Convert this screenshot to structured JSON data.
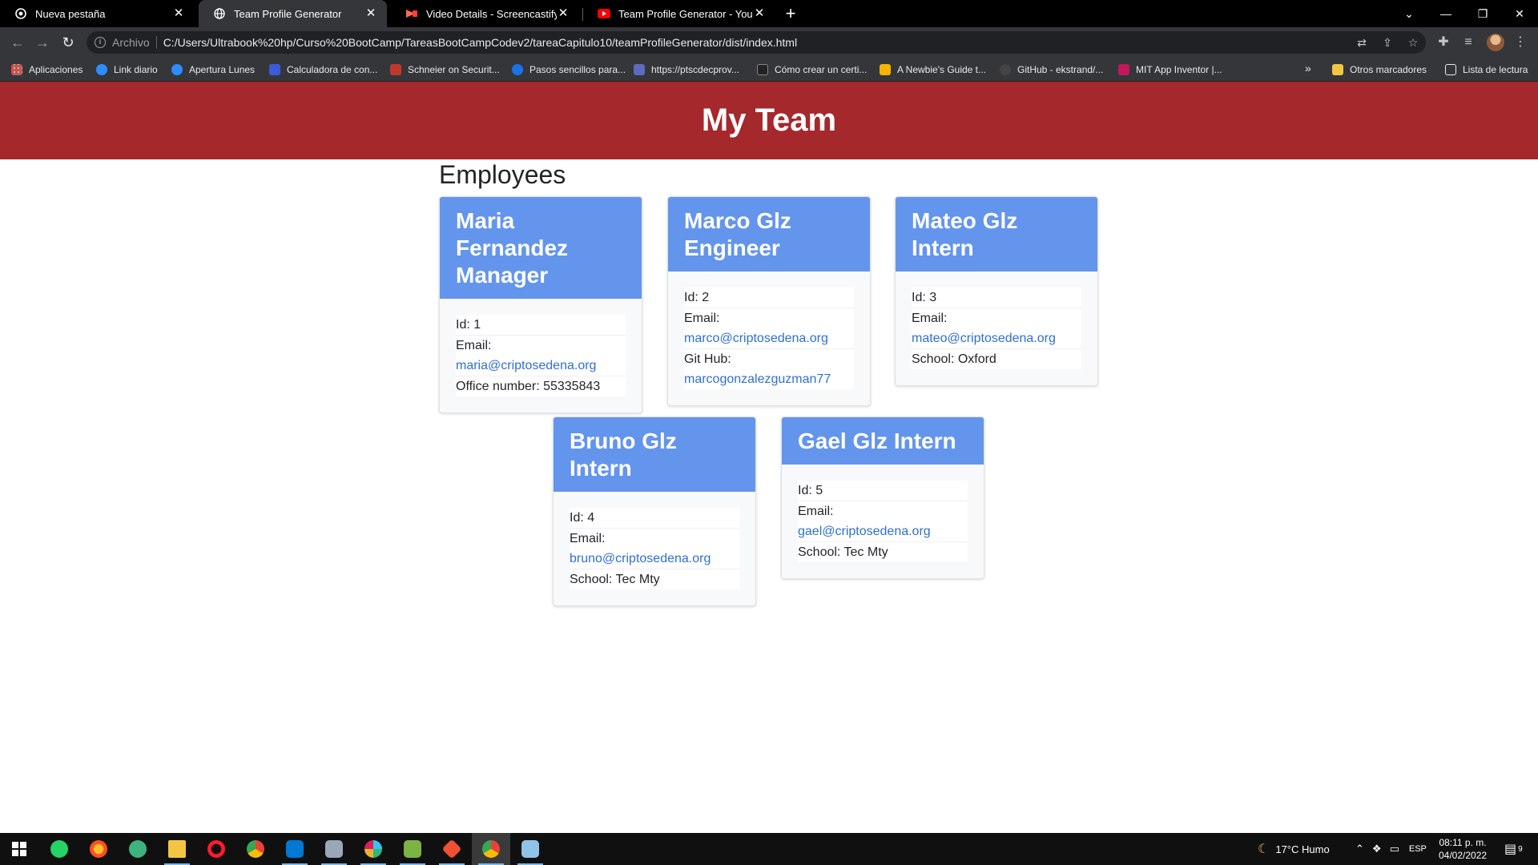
{
  "browser": {
    "tabs": [
      {
        "title": "Nueva pestaña",
        "icon": "chrome-icon",
        "active": false
      },
      {
        "title": "Team Profile Generator",
        "icon": "globe-icon",
        "active": true
      },
      {
        "title": "Video Details - Screencastify",
        "icon": "screencastify-icon",
        "active": false
      },
      {
        "title": "Team Profile Generator - YouTube",
        "icon": "youtube-icon",
        "active": false
      }
    ],
    "new_tab_label": "+",
    "address": {
      "scheme_label": "Archivo",
      "url": "C:/Users/Ultrabook%20hp/Curso%20BootCamp/TareasBootCampCodev2/tareaCapitulo10/teamProfileGenerator/dist/index.html"
    },
    "bookmarks": [
      {
        "label": "Aplicaciones",
        "color": "#e8453c"
      },
      {
        "label": "Link diario",
        "color": "#2d8cff"
      },
      {
        "label": "Apertura Lunes",
        "color": "#2d8cff"
      },
      {
        "label": "Calculadora de con...",
        "color": "#3b5bdb"
      },
      {
        "label": "Schneier on Securit...",
        "color": "#c0392b"
      },
      {
        "label": "Pasos sencillos para...",
        "color": "#1a73e8"
      },
      {
        "label": "https://ptscdecprov...",
        "color": "#5c6bc0"
      },
      {
        "label": "Cómo crear un certi...",
        "color": "#222222"
      },
      {
        "label": "A Newbie's Guide t...",
        "color": "#f4b400"
      },
      {
        "label": "GitHub - ekstrand/...",
        "color": "#444444"
      },
      {
        "label": "MIT App Inventor |...",
        "color": "#c2185b"
      }
    ],
    "bookmarks_more": "»",
    "other_bookmarks": "Otros marcadores",
    "reading_list": "Lista de lectura"
  },
  "page": {
    "header_title": "My Team",
    "section_title": "Employees",
    "employees": [
      {
        "name": "Maria Fernandez",
        "role": "Manager",
        "id_label": "Id: 1",
        "email_label": "Email:",
        "email": "maria@criptosedena.org",
        "extra_label": "Office number: 55335843",
        "extra_link": ""
      },
      {
        "name": "Marco Glz",
        "role": "Engineer",
        "id_label": "Id: 2",
        "email_label": "Email:",
        "email": "marco@criptosedena.org",
        "extra_label": "Git Hub:",
        "extra_link": "marcogonzalezguzman77"
      },
      {
        "name": "Mateo Glz",
        "role": "Intern",
        "id_label": "Id: 3",
        "email_label": "Email:",
        "email": "mateo@criptosedena.org",
        "extra_label": "School: Oxford",
        "extra_link": ""
      },
      {
        "name": "Bruno Glz",
        "role": "Intern",
        "id_label": "Id: 4",
        "email_label": "Email:",
        "email": "bruno@criptosedena.org",
        "extra_label": "School: Tec Mty",
        "extra_link": ""
      },
      {
        "name": "Gael Glz",
        "role": "Intern",
        "id_label": "Id: 5",
        "email_label": "Email:",
        "email": "gael@criptosedena.org",
        "extra_label": "School: Tec Mty",
        "extra_link": ""
      }
    ],
    "colors": {
      "header": "#a5282c",
      "card_header": "#6495ed",
      "link": "#2f6fd1"
    }
  },
  "taskbar": {
    "weather": "17°C  Humo",
    "language": "ESP",
    "time": "08:11 p. m.",
    "date": "04/02/2022",
    "notifications": "9"
  }
}
